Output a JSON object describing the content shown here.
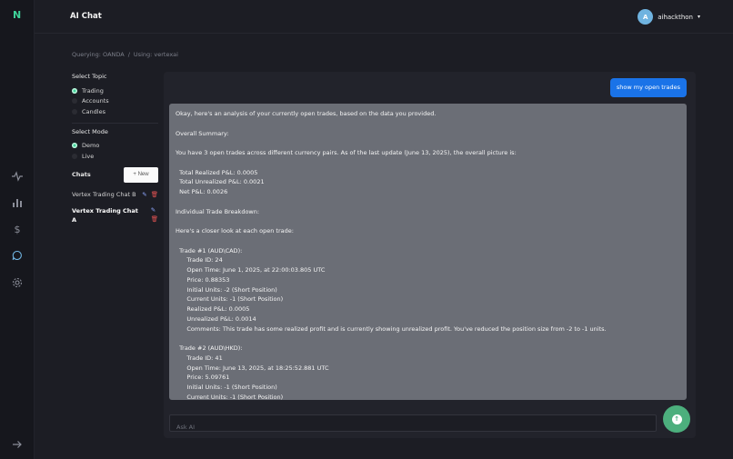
{
  "app": {
    "logo": "N",
    "title": "AI Chat"
  },
  "user": {
    "avatar_letter": "A",
    "name": "aihackthon",
    "caret": "▾"
  },
  "breadcrumb": {
    "querying": "Querying: OANDA",
    "sep": "/",
    "using": "Using: vertexai"
  },
  "topic": {
    "heading": "Select Topic",
    "options": [
      {
        "label": "Trading",
        "selected": true
      },
      {
        "label": "Accounts",
        "selected": false
      },
      {
        "label": "Candles",
        "selected": false
      }
    ]
  },
  "mode": {
    "heading": "Select Mode",
    "options": [
      {
        "label": "Demo",
        "selected": true
      },
      {
        "label": "Live",
        "selected": false
      }
    ]
  },
  "chats": {
    "heading": "Chats",
    "new_label": "+ New",
    "items": [
      {
        "label": "Vertex Trading Chat B"
      },
      {
        "label": "Vertex Trading Chat A"
      }
    ]
  },
  "conversation": {
    "user_message": "show my open trades",
    "ai_lines": [
      "Okay, here's an analysis of your currently open trades, based on the data you provided.",
      "",
      "Overall Summary:",
      "",
      "You have 3 open trades across different currency pairs. As of the last update (June 13, 2025), the overall picture is:",
      "",
      "  Total Realized P&L: 0.0005",
      "  Total Unrealized P&L: 0.0021",
      "  Net P&L: 0.0026",
      "",
      "Individual Trade Breakdown:",
      "",
      "Here's a closer look at each open trade:",
      "",
      "  Trade #1 (AUD\\CAD):",
      "      Trade ID: 24",
      "      Open Time: June 1, 2025, at 22:00:03.805 UTC",
      "      Price: 0.88353",
      "      Initial Units: -2 (Short Position)",
      "      Current Units: -1 (Short Position)",
      "      Realized P&L: 0.0005",
      "      Unrealized P&L: 0.0014",
      "      Comments: This trade has some realized profit and is currently showing unrealized profit. You've reduced the position size from -2 to -1 units.",
      "",
      "  Trade #2 (AUD\\HKD):",
      "      Trade ID: 41",
      "      Open Time: June 13, 2025, at 18:25:52.881 UTC",
      "      Price: 5.09761",
      "      Initial Units: -1 (Short Position)",
      "      Current Units: -1 (Short Position)"
    ]
  },
  "composer": {
    "placeholder": "Ask AI"
  },
  "icons": {
    "accent": "#3fd39a",
    "send_color": "#4caf7d",
    "user_bubble": "#1a73e8"
  }
}
